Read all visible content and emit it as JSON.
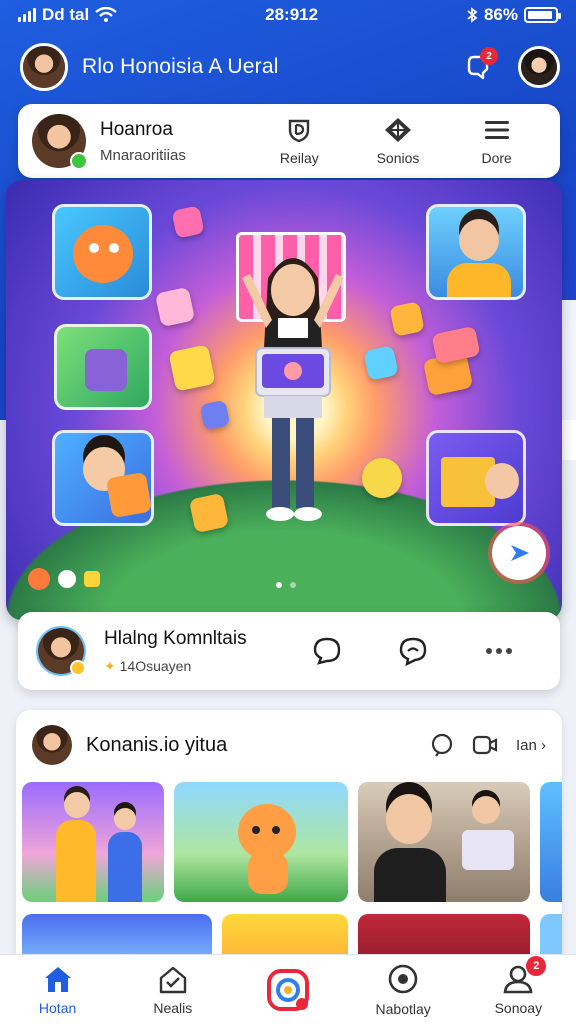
{
  "status_bar": {
    "carrier": "Dd tal",
    "time": "28:912",
    "battery": "86%"
  },
  "header": {
    "title": "Rlo Honoisia A Ueral",
    "notification_count": "2"
  },
  "profile": {
    "name": "Hoanroa",
    "subtitle": "Mnaraoritiias",
    "actions": [
      {
        "label": "Reilay",
        "icon": "shield-icon"
      },
      {
        "label": "Sonios",
        "icon": "diamond-icon"
      },
      {
        "label": "Dore",
        "icon": "menu-icon"
      }
    ]
  },
  "post": {
    "name": "Hlalng Komnltais",
    "meta": "14Osuayen"
  },
  "section": {
    "title": "Konanis.io yitua",
    "more_label": "Ian"
  },
  "nav": {
    "items": [
      {
        "label": "Hotan",
        "icon": "home-icon",
        "active": true
      },
      {
        "label": "Nealis",
        "icon": "check-house-icon"
      },
      {
        "label": "",
        "icon": "camera-icon"
      },
      {
        "label": "Nabotlay",
        "icon": "target-icon"
      },
      {
        "label": "Sonoay",
        "icon": "profile-icon",
        "badge": "2"
      }
    ]
  },
  "colors": {
    "primary": "#1f5ee0",
    "badge": "#e8283a",
    "online": "#3ec43e"
  }
}
